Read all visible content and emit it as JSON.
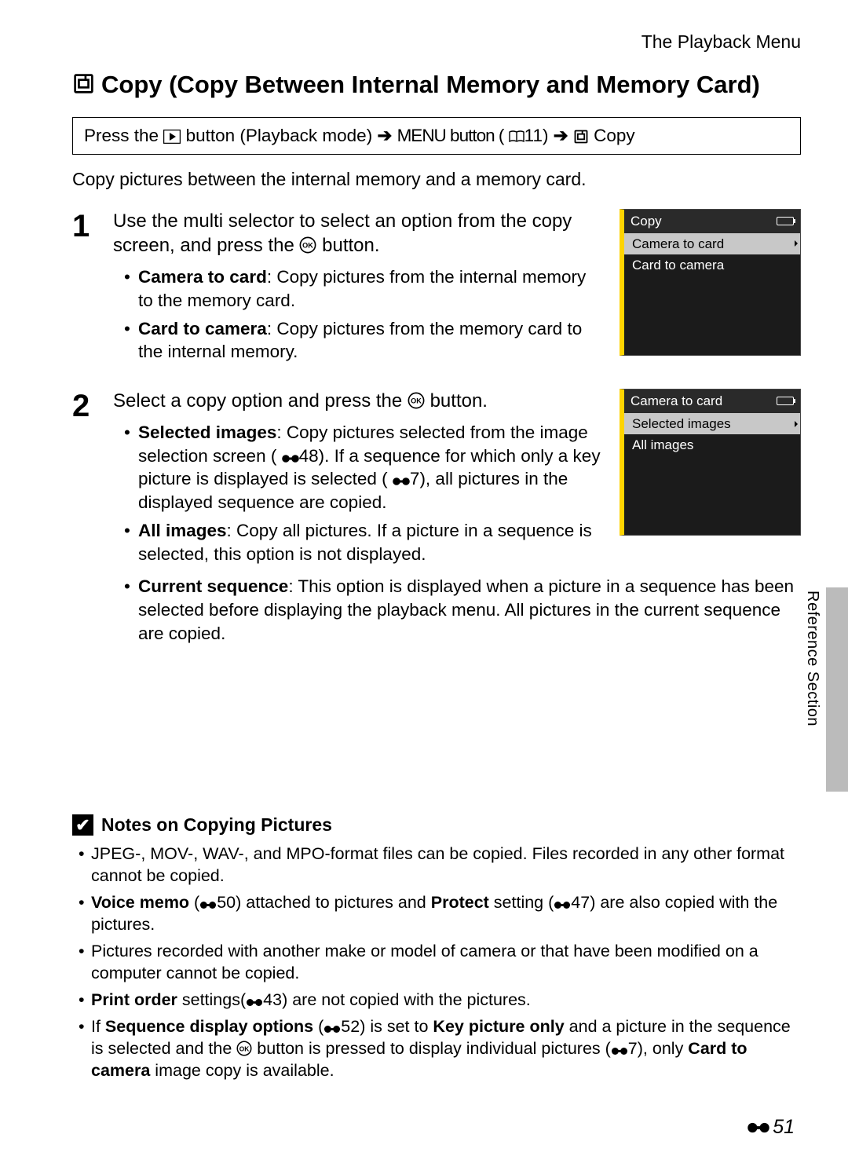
{
  "header": {
    "section": "The Playback Menu"
  },
  "title": {
    "text": "Copy (Copy Between Internal Memory and Memory Card)"
  },
  "nav": {
    "press_the": "Press the ",
    "button_playback": " button (Playback mode) ",
    "arrow": "➔",
    "menu_button": " MENU button (",
    "page_ref": "11) ",
    "copy": " Copy"
  },
  "intro": "Copy pictures between the internal memory and a memory card.",
  "steps": [
    {
      "num": "1",
      "heading_a": "Use the multi selector to select an option from the copy screen, and press the ",
      "heading_b": " button.",
      "bullets": [
        {
          "bold": "Camera to card",
          "rest": ": Copy pictures from the internal memory to the memory card."
        },
        {
          "bold": "Card to camera",
          "rest": ": Copy pictures from the memory card to the internal memory."
        }
      ],
      "menu": {
        "title": "Copy",
        "items": [
          "Camera to card",
          "Card to camera"
        ],
        "selected": 0
      }
    },
    {
      "num": "2",
      "heading_a": "Select a copy option and press the ",
      "heading_b": " button.",
      "bullets": [
        {
          "bold": "Selected images",
          "rest": ": Copy pictures selected from the image selection screen (",
          "ref": "48",
          "rest2": "). If a sequence for which only a key picture is displayed is selected (",
          "ref2": "7",
          "rest3": "), all pictures in the displayed sequence are copied."
        },
        {
          "bold": "All images",
          "rest": ": Copy all pictures. If a picture in a sequence is selected, this option is not displayed."
        },
        {
          "bold": "Current sequence",
          "rest": ": This option is displayed when a picture in a sequence has been selected before displaying the playback menu. All pictures in the current sequence are copied."
        }
      ],
      "menu": {
        "title": "Camera to card",
        "items": [
          "Selected images",
          "All images"
        ],
        "selected": 0
      }
    }
  ],
  "notes": {
    "heading": "Notes on Copying Pictures",
    "check": "✔",
    "items": [
      {
        "text": "JPEG-, MOV-, WAV-, and MPO-format files can be copied. Files recorded in any other format cannot be copied."
      },
      {
        "bold1": "Voice memo",
        "ref1": "50",
        "mid1": ") attached to pictures and ",
        "bold2": "Protect",
        "mid2": " setting (",
        "ref2": "47",
        "tail": ") are also copied with the pictures."
      },
      {
        "text": "Pictures recorded with another make or model of camera or that have been modified on a computer cannot be copied."
      },
      {
        "bold1": "Print order",
        "mid1": " settings(",
        "ref1": "43",
        "tail": ") are not copied with the pictures."
      },
      {
        "pre": "If ",
        "bold1": "Sequence display options",
        "mid1": " (",
        "ref1": "52",
        "mid2": ") is set to ",
        "bold2": "Key picture only",
        "mid3": " and a picture in the sequence is selected and the ",
        "ok": "OK",
        "mid4": " button is pressed to display individual pictures (",
        "ref2": "7",
        "mid5": "), only ",
        "bold3": "Card to camera",
        "tail": " image copy is available."
      }
    ]
  },
  "side_label": "Reference Section",
  "page_number": "51"
}
